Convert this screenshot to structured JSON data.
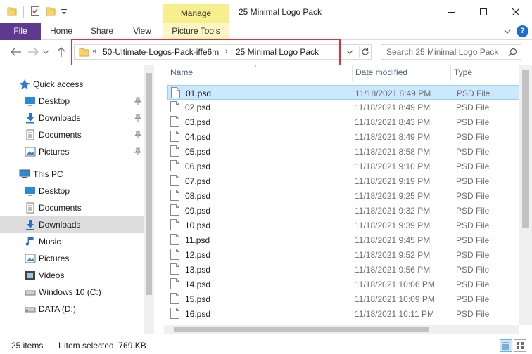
{
  "window": {
    "title": "25 Minimal Logo Pack",
    "context_tab": "Manage"
  },
  "ribbon": {
    "tabs": [
      "File",
      "Home",
      "Share",
      "View",
      "Picture Tools"
    ],
    "help": "?"
  },
  "address": {
    "overflow": "«",
    "crumbs": [
      "50-Ultimate-Logos-Pack-iffe6m",
      "25 Minimal Logo Pack"
    ],
    "separator": "›"
  },
  "search": {
    "placeholder": "Search 25 Minimal Logo Pack"
  },
  "nav": {
    "items": [
      {
        "label": "Quick access",
        "icon": "star-icon",
        "level": "top",
        "pinned": false,
        "selected": false
      },
      {
        "label": "Desktop",
        "icon": "desktop-icon",
        "level": "child",
        "pinned": true,
        "selected": false
      },
      {
        "label": "Downloads",
        "icon": "download-icon",
        "level": "child",
        "pinned": true,
        "selected": false
      },
      {
        "label": "Documents",
        "icon": "documents-icon",
        "level": "child",
        "pinned": true,
        "selected": false
      },
      {
        "label": "Pictures",
        "icon": "pictures-icon",
        "level": "child",
        "pinned": true,
        "selected": false
      },
      {
        "label": "This PC",
        "icon": "computer-icon",
        "level": "top",
        "pinned": false,
        "selected": false
      },
      {
        "label": "Desktop",
        "icon": "desktop-icon",
        "level": "child",
        "pinned": false,
        "selected": false
      },
      {
        "label": "Documents",
        "icon": "documents-icon",
        "level": "child",
        "pinned": false,
        "selected": false
      },
      {
        "label": "Downloads",
        "icon": "download-icon",
        "level": "child",
        "pinned": false,
        "selected": true
      },
      {
        "label": "Music",
        "icon": "music-icon",
        "level": "child",
        "pinned": false,
        "selected": false
      },
      {
        "label": "Pictures",
        "icon": "pictures-icon",
        "level": "child",
        "pinned": false,
        "selected": false
      },
      {
        "label": "Videos",
        "icon": "videos-icon",
        "level": "child",
        "pinned": false,
        "selected": false
      },
      {
        "label": "Windows 10 (C:)",
        "icon": "drive-icon",
        "level": "child",
        "pinned": false,
        "selected": false
      },
      {
        "label": "DATA (D:)",
        "icon": "drive-icon",
        "level": "child",
        "pinned": false,
        "selected": false
      }
    ]
  },
  "files": {
    "columns": {
      "name": "Name",
      "date": "Date modified",
      "type": "Type"
    },
    "rows": [
      {
        "name": "01.psd",
        "date": "11/18/2021 8:49 PM",
        "type": "PSD File",
        "selected": true
      },
      {
        "name": "02.psd",
        "date": "11/18/2021 8:49 PM",
        "type": "PSD File",
        "selected": false
      },
      {
        "name": "03.psd",
        "date": "11/18/2021 8:43 PM",
        "type": "PSD File",
        "selected": false
      },
      {
        "name": "04.psd",
        "date": "11/18/2021 8:49 PM",
        "type": "PSD File",
        "selected": false
      },
      {
        "name": "05.psd",
        "date": "11/18/2021 8:58 PM",
        "type": "PSD File",
        "selected": false
      },
      {
        "name": "06.psd",
        "date": "11/18/2021 9:10 PM",
        "type": "PSD File",
        "selected": false
      },
      {
        "name": "07.psd",
        "date": "11/18/2021 9:19 PM",
        "type": "PSD File",
        "selected": false
      },
      {
        "name": "08.psd",
        "date": "11/18/2021 9:25 PM",
        "type": "PSD File",
        "selected": false
      },
      {
        "name": "09.psd",
        "date": "11/18/2021 9:32 PM",
        "type": "PSD File",
        "selected": false
      },
      {
        "name": "10.psd",
        "date": "11/18/2021 9:39 PM",
        "type": "PSD File",
        "selected": false
      },
      {
        "name": "11.psd",
        "date": "11/18/2021 9:45 PM",
        "type": "PSD File",
        "selected": false
      },
      {
        "name": "12.psd",
        "date": "11/18/2021 9:52 PM",
        "type": "PSD File",
        "selected": false
      },
      {
        "name": "13.psd",
        "date": "11/18/2021 9:56 PM",
        "type": "PSD File",
        "selected": false
      },
      {
        "name": "14.psd",
        "date": "11/18/2021 10:06 PM",
        "type": "PSD File",
        "selected": false
      },
      {
        "name": "15.psd",
        "date": "11/18/2021 10:09 PM",
        "type": "PSD File",
        "selected": false
      },
      {
        "name": "16.psd",
        "date": "11/18/2021 10:11 PM",
        "type": "PSD File",
        "selected": false
      }
    ]
  },
  "status": {
    "count": "25 items",
    "selection": "1 item selected  769 KB"
  },
  "colors": {
    "file_tab": "#5d3a8f",
    "manage_tab": "#f7ee8d",
    "selection": "#cce8ff",
    "highlight_box": "#e0303a"
  }
}
